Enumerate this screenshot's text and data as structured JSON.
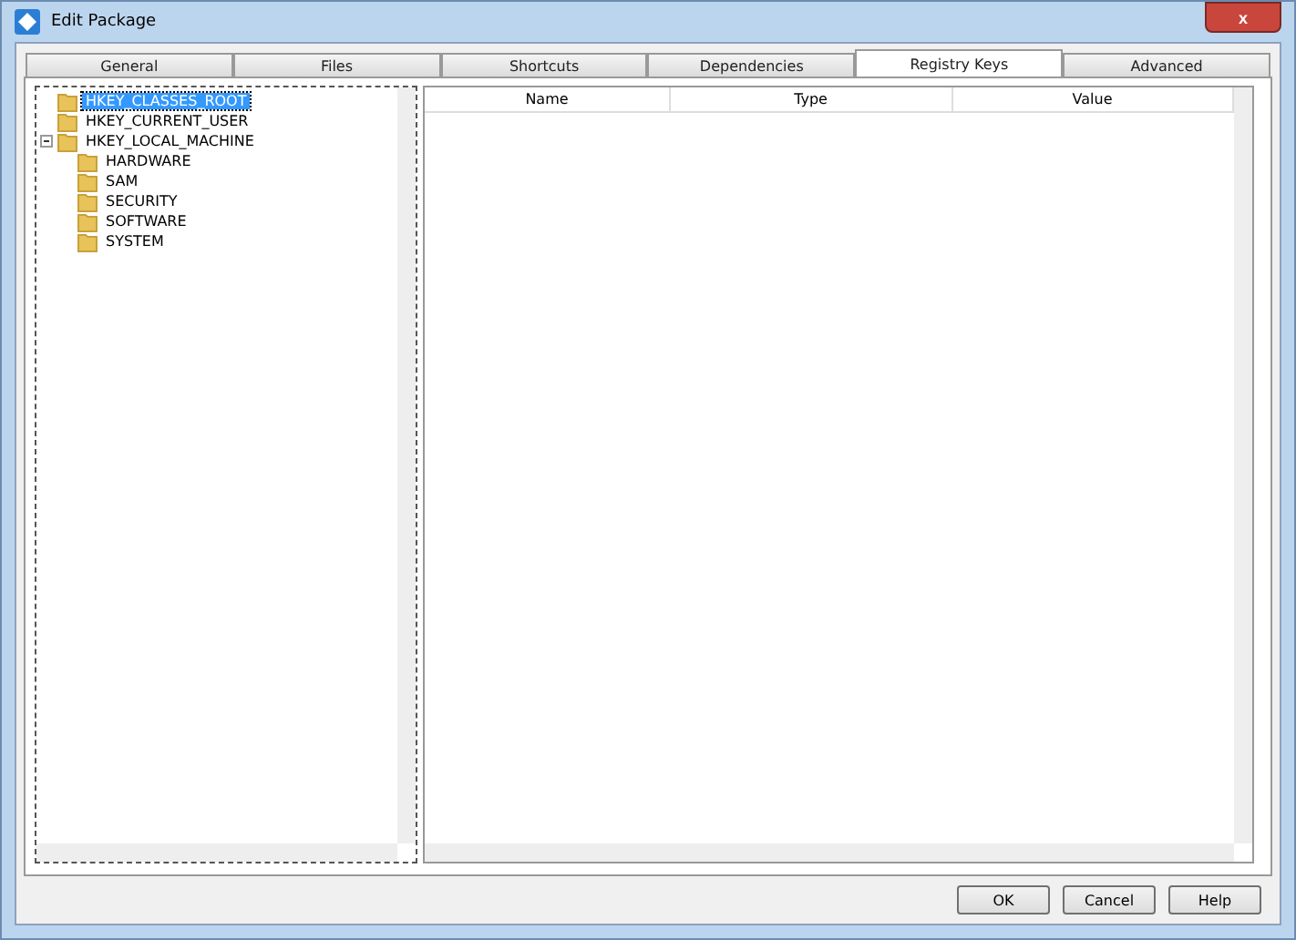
{
  "window": {
    "title": "Edit Package",
    "close": "x"
  },
  "tabs": [
    {
      "label": "General",
      "selected": false
    },
    {
      "label": "Files",
      "selected": false
    },
    {
      "label": "Shortcuts",
      "selected": false
    },
    {
      "label": "Dependencies",
      "selected": false
    },
    {
      "label": "Registry Keys",
      "selected": true
    },
    {
      "label": "Advanced",
      "selected": false
    }
  ],
  "tree": [
    {
      "label": "HKEY_CLASSES_ROOT",
      "selected": true,
      "expanded": false
    },
    {
      "label": "HKEY_CURRENT_USER",
      "selected": false,
      "expanded": false
    },
    {
      "label": "HKEY_LOCAL_MACHINE",
      "selected": false,
      "expanded": true,
      "children": [
        {
          "label": "HARDWARE",
          "selected": false,
          "expanded": false
        },
        {
          "label": "SAM",
          "selected": false,
          "expanded": false
        },
        {
          "label": "SECURITY",
          "selected": false,
          "expanded": false
        },
        {
          "label": "SOFTWARE",
          "selected": false,
          "expanded": false
        },
        {
          "label": "SYSTEM",
          "selected": false,
          "expanded": false
        }
      ]
    }
  ],
  "table": {
    "columns": [
      "Name",
      "Type",
      "Value"
    ]
  },
  "buttons": [
    "OK",
    "Cancel",
    "Help"
  ]
}
